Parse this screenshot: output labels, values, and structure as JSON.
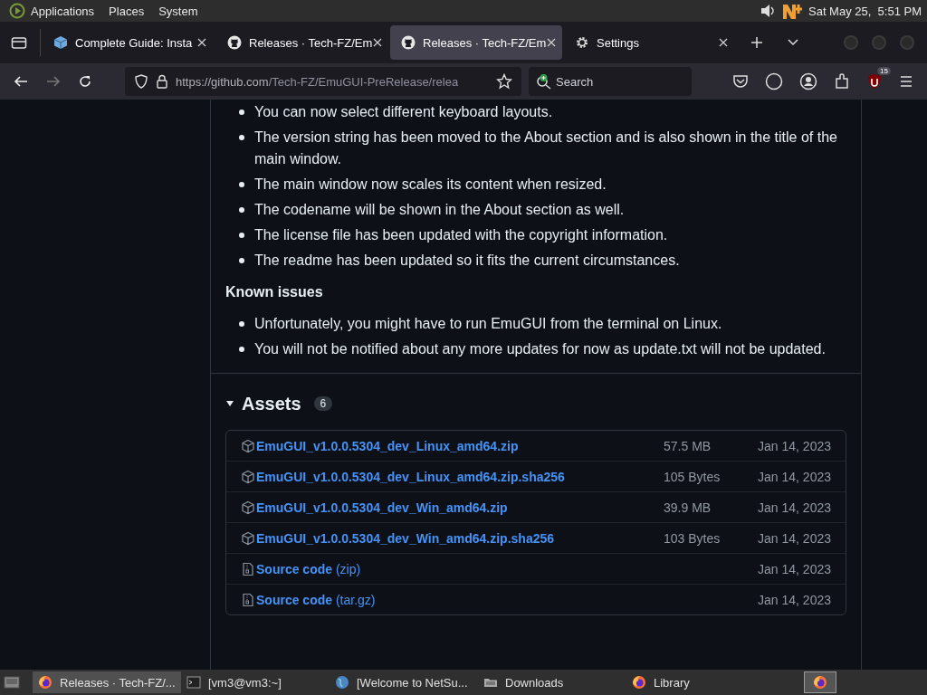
{
  "top_panel": {
    "menus": [
      "Applications",
      "Places",
      "System"
    ],
    "clock": "Sat May 25,  5:51 PM"
  },
  "tabs": [
    {
      "title": "Complete Guide: Insta",
      "kind": "cube",
      "selected": false
    },
    {
      "title": "Releases · Tech-FZ/Em",
      "kind": "github",
      "selected": false
    },
    {
      "title": "Releases · Tech-FZ/Em",
      "kind": "github",
      "selected": true
    },
    {
      "title": "Settings",
      "kind": "gear",
      "selected": false
    }
  ],
  "nav": {
    "url_host": "https://github.com",
    "url_path": "/Tech-FZ/EmuGUI-PreRelease/relea",
    "search_placeholder": "Search",
    "extension_badge": "15"
  },
  "release": {
    "changes": [
      "You can now select different keyboard layouts.",
      "The version string has been moved to the About section and is also shown in the title of the main window.",
      "The main window now scales its content when resized.",
      "The codename will be shown in the About section as well.",
      "The license file has been updated with the copyright information.",
      "The readme has been updated so it fits the current circumstances."
    ],
    "known_issues_heading": "Known issues",
    "known_issues": [
      "Unfortunately, you might have to run EmuGUI from the terminal on Linux.",
      "You will not be notified about any more updates for now as update.txt will not be updated."
    ],
    "assets_title": "Assets",
    "assets_count": "6",
    "expanded": true,
    "assets": [
      {
        "kind": "package",
        "name": "EmuGUI_v1.0.0.5304_dev_Linux_amd64.zip",
        "size": "57.5 MB",
        "date": "Jan 14, 2023"
      },
      {
        "kind": "package",
        "name": "EmuGUI_v1.0.0.5304_dev_Linux_amd64.zip.sha256",
        "size": "105 Bytes",
        "date": "Jan 14, 2023"
      },
      {
        "kind": "package",
        "name": "EmuGUI_v1.0.0.5304_dev_Win_amd64.zip",
        "size": "39.9 MB",
        "date": "Jan 14, 2023"
      },
      {
        "kind": "package",
        "name": "EmuGUI_v1.0.0.5304_dev_Win_amd64.zip.sha256",
        "size": "103 Bytes",
        "date": "Jan 14, 2023"
      },
      {
        "kind": "source",
        "name": "Source code",
        "suffix": "(zip)",
        "date": "Jan 14, 2023"
      },
      {
        "kind": "source",
        "name": "Source code",
        "suffix": "(tar.gz)",
        "date": "Jan 14, 2023"
      }
    ]
  },
  "taskbar": [
    {
      "label": "Releases · Tech-FZ/...",
      "kind": "firefox",
      "selected": true
    },
    {
      "label": "[vm3@vm3:~]",
      "kind": "terminal",
      "selected": false
    },
    {
      "label": "[Welcome to NetSu...",
      "kind": "globe",
      "selected": false
    },
    {
      "label": "Downloads",
      "kind": "folder",
      "selected": false
    },
    {
      "label": "Library",
      "kind": "firefox",
      "selected": false
    }
  ]
}
